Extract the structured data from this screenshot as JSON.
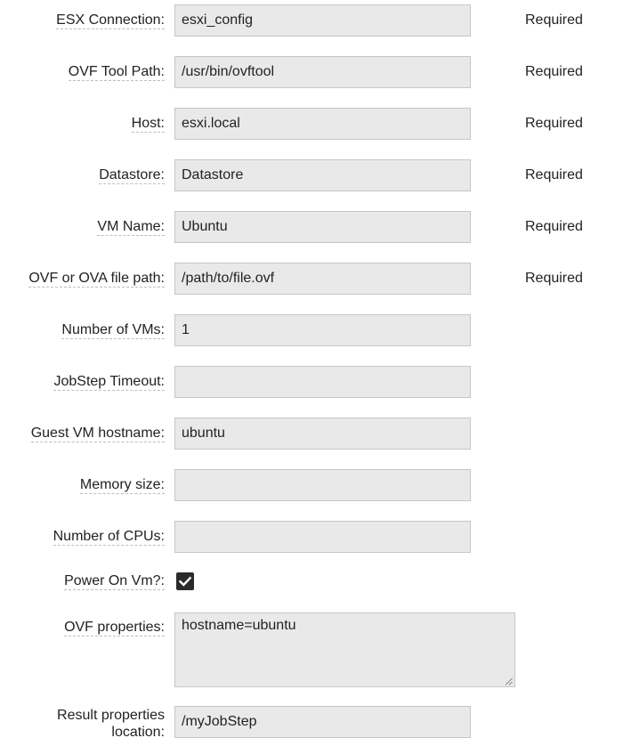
{
  "form": {
    "fields": [
      {
        "label": "ESX Connection:",
        "value": "esxi_config",
        "required": "Required"
      },
      {
        "label": "OVF Tool Path:",
        "value": "/usr/bin/ovftool",
        "required": "Required"
      },
      {
        "label": "Host:",
        "value": "esxi.local",
        "required": "Required"
      },
      {
        "label": "Datastore:",
        "value": "Datastore",
        "required": "Required"
      },
      {
        "label": "VM Name:",
        "value": "Ubuntu",
        "required": "Required"
      },
      {
        "label": "OVF or OVA file path:",
        "value": "/path/to/file.ovf",
        "required": "Required"
      },
      {
        "label": "Number of VMs:",
        "value": "1"
      },
      {
        "label": "JobStep Timeout:",
        "value": ""
      },
      {
        "label": "Guest VM hostname:",
        "value": "ubuntu"
      },
      {
        "label": "Memory size:",
        "value": ""
      },
      {
        "label": "Number of CPUs:",
        "value": ""
      }
    ],
    "power_on": {
      "label": "Power On Vm?:",
      "checked": true
    },
    "ovf_properties": {
      "label": "OVF properties:",
      "value": "hostname=ubuntu"
    },
    "result_properties": {
      "label_line1": "Result properties",
      "label_line2": "location:",
      "value": "/myJobStep"
    }
  }
}
